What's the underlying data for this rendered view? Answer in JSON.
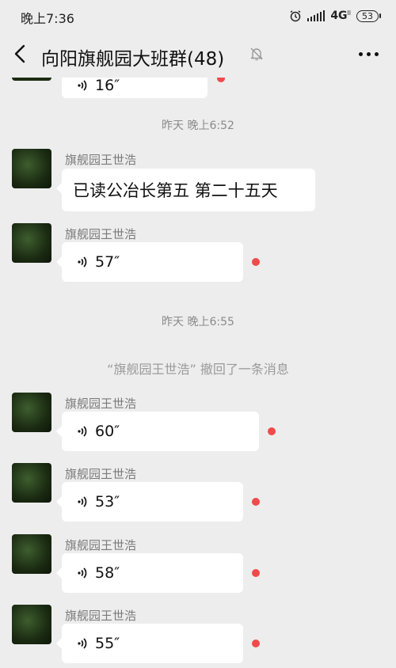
{
  "status_bar": {
    "time": "晚上7:36",
    "network": "4G",
    "network_sub": "ll",
    "battery": "53"
  },
  "header": {
    "title": "向阳旗舰园大班群(48)"
  },
  "messages": {
    "top_partial_duration": "16″",
    "ts1": "昨天 晚上6:52",
    "m1": {
      "sender": "旗舰园王世浩",
      "text": "已读公冶长第五  第二十五天"
    },
    "m2": {
      "sender": "旗舰园王世浩",
      "duration": "57″"
    },
    "ts2": "昨天 晚上6:55",
    "recall_notice": "“旗舰园王世浩” 撤回了一条消息",
    "m3": {
      "sender": "旗舰园王世浩",
      "duration": "60″"
    },
    "m4": {
      "sender": "旗舰园王世浩",
      "duration": "53″"
    },
    "m5": {
      "sender": "旗舰园王世浩",
      "duration": "58″"
    },
    "m6": {
      "sender": "旗舰园王世浩",
      "duration": "55″"
    }
  },
  "colors": {
    "background": "#ededed",
    "bubble": "#ffffff",
    "unread_dot": "#f04a4a"
  }
}
